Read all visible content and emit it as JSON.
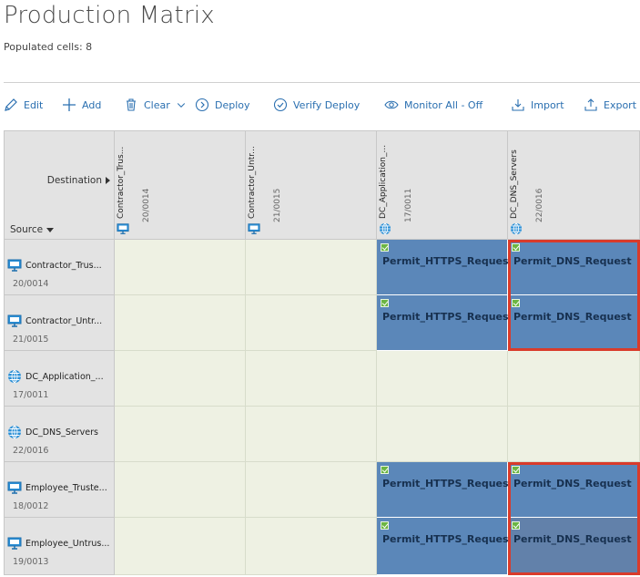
{
  "page": {
    "title": "Production Matrix",
    "populated_label": "Populated cells: 8"
  },
  "toolbar": {
    "edit": "Edit",
    "add": "Add",
    "clear": "Clear",
    "deploy": "Deploy",
    "verify_deploy": "Verify Deploy",
    "monitor": "Monitor All - Off",
    "import": "Import",
    "export": "Export"
  },
  "matrix": {
    "destination_label": "Destination",
    "source_label": "Source",
    "columns": [
      {
        "name": "Contractor_Trus...",
        "id": "20/0014",
        "icon": "monitor-icon"
      },
      {
        "name": "Contractor_Untr...",
        "id": "21/0015",
        "icon": "monitor-icon"
      },
      {
        "name": "DC_Application_...",
        "id": "17/0011",
        "icon": "globe-icon"
      },
      {
        "name": "DC_DNS_Servers",
        "id": "22/0016",
        "icon": "globe-icon"
      }
    ],
    "rows": [
      {
        "name": "Contractor_Trus...",
        "id": "20/0014",
        "icon": "monitor-icon"
      },
      {
        "name": "Contractor_Untr...",
        "id": "21/0015",
        "icon": "monitor-icon"
      },
      {
        "name": "DC_Application_...",
        "id": "17/0011",
        "icon": "globe-icon"
      },
      {
        "name": "DC_DNS_Servers",
        "id": "22/0016",
        "icon": "globe-icon"
      },
      {
        "name": "Employee_Truste...",
        "id": "18/0012",
        "icon": "monitor-icon"
      },
      {
        "name": "Employee_Untrus...",
        "id": "19/0013",
        "icon": "monitor-icon"
      }
    ],
    "policies": {
      "https": "Permit_HTTPS_Request",
      "dns": "Permit_DNS_Request"
    }
  },
  "colors": {
    "accent": "#2a6fb0",
    "filled_cell": "#5b87b9",
    "highlight": "#d93b2b",
    "empty_cell": "#eef1e3",
    "check": "#6bb543"
  }
}
